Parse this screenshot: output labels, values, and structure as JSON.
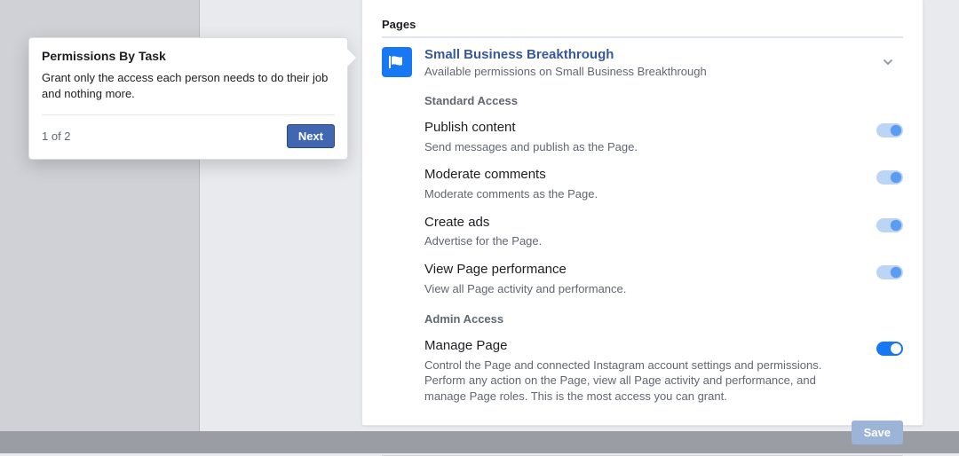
{
  "tooltip": {
    "title": "Permissions By Task",
    "body": "Grant only the access each person needs to do their job and nothing more.",
    "step": "1 of 2",
    "next_label": "Next"
  },
  "panel": {
    "section": "Pages",
    "page": {
      "name": "Small Business Breakthrough",
      "subtitle": "Available permissions on Small Business Breakthrough"
    },
    "groups": [
      {
        "heading": "Standard Access",
        "items": [
          {
            "title": "Publish content",
            "desc": "Send messages and publish as the Page.",
            "on": true,
            "strong": false
          },
          {
            "title": "Moderate comments",
            "desc": "Moderate comments as the Page.",
            "on": true,
            "strong": false
          },
          {
            "title": "Create ads",
            "desc": "Advertise for the Page.",
            "on": true,
            "strong": false
          },
          {
            "title": "View Page performance",
            "desc": "View all Page activity and performance.",
            "on": true,
            "strong": false
          }
        ]
      },
      {
        "heading": "Admin Access",
        "items": [
          {
            "title": "Manage Page",
            "desc": "Control the Page and connected Instagram account settings and permissions. Perform any action on the Page, view all Page activity and performance, and manage Page roles. This is the most access you can grant.",
            "on": true,
            "strong": true
          }
        ]
      }
    ],
    "save_label": "Save"
  }
}
